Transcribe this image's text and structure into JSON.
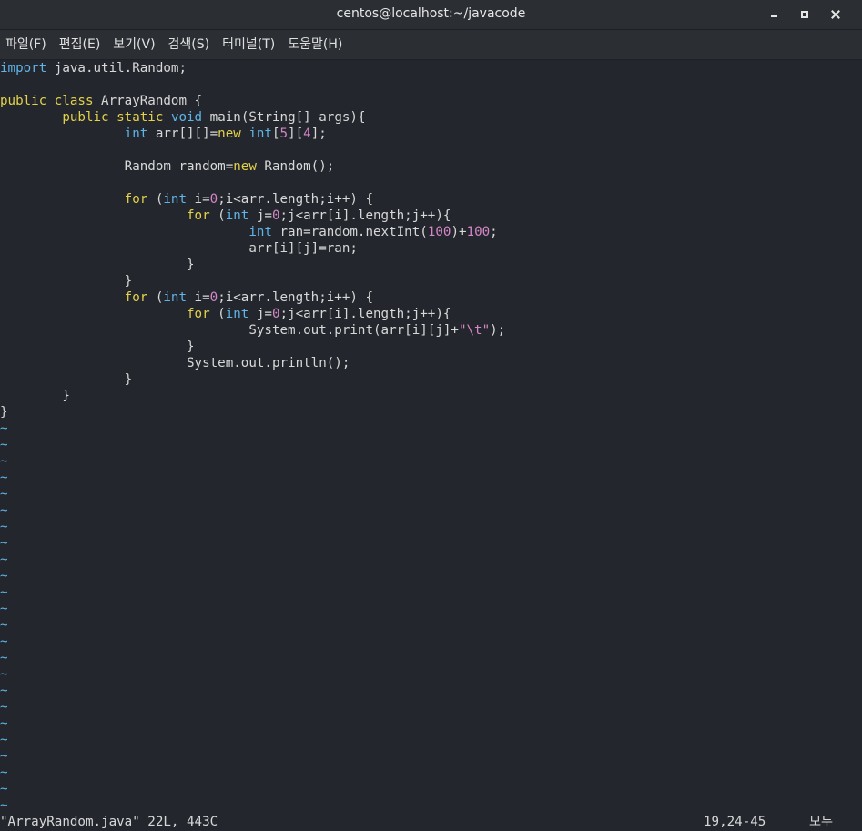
{
  "window": {
    "title": "centos@localhost:~/javacode",
    "controls": [
      "minimize",
      "maximize",
      "close"
    ]
  },
  "menu": [
    "파일(F)",
    "편집(E)",
    "보기(V)",
    "검색(S)",
    "터미널(T)",
    "도움말(H)"
  ],
  "code_lines": [
    [
      [
        "kw2",
        "import"
      ],
      [
        "t",
        " java.util.Random;"
      ]
    ],
    [],
    [
      [
        "kw",
        "public"
      ],
      [
        "t",
        " "
      ],
      [
        "kw",
        "class"
      ],
      [
        "t",
        " ArrayRandom {"
      ]
    ],
    [
      [
        "t",
        "        "
      ],
      [
        "kw",
        "public"
      ],
      [
        "t",
        " "
      ],
      [
        "kw",
        "static"
      ],
      [
        "t",
        " "
      ],
      [
        "ty",
        "void"
      ],
      [
        "t",
        " main(String[] args){"
      ]
    ],
    [
      [
        "t",
        "                "
      ],
      [
        "ty",
        "int"
      ],
      [
        "t",
        " arr[][]="
      ],
      [
        "kw",
        "new"
      ],
      [
        "t",
        " "
      ],
      [
        "ty",
        "int"
      ],
      [
        "t",
        "["
      ],
      [
        "nm",
        "5"
      ],
      [
        "t",
        "]["
      ],
      [
        "nm",
        "4"
      ],
      [
        "t",
        "];"
      ]
    ],
    [],
    [
      [
        "t",
        "                Random random="
      ],
      [
        "kw",
        "new"
      ],
      [
        "t",
        " Random();"
      ]
    ],
    [],
    [
      [
        "t",
        "                "
      ],
      [
        "kw",
        "for"
      ],
      [
        "t",
        " ("
      ],
      [
        "ty",
        "int"
      ],
      [
        "t",
        " i="
      ],
      [
        "nm",
        "0"
      ],
      [
        "t",
        ";i<arr.length;i++) {"
      ]
    ],
    [
      [
        "t",
        "                        "
      ],
      [
        "kw",
        "for"
      ],
      [
        "t",
        " ("
      ],
      [
        "ty",
        "int"
      ],
      [
        "t",
        " j="
      ],
      [
        "nm",
        "0"
      ],
      [
        "t",
        ";j<arr[i].length;j++){"
      ]
    ],
    [
      [
        "t",
        "                                "
      ],
      [
        "ty",
        "int"
      ],
      [
        "t",
        " ran=random.nextInt("
      ],
      [
        "nm",
        "100"
      ],
      [
        "t",
        ")+"
      ],
      [
        "nm",
        "100"
      ],
      [
        "t",
        ";"
      ]
    ],
    [
      [
        "t",
        "                                arr[i][j]=ran;"
      ]
    ],
    [
      [
        "t",
        "                        }"
      ]
    ],
    [
      [
        "t",
        "                }"
      ]
    ],
    [
      [
        "t",
        "                "
      ],
      [
        "kw",
        "for"
      ],
      [
        "t",
        " ("
      ],
      [
        "ty",
        "int"
      ],
      [
        "t",
        " i="
      ],
      [
        "nm",
        "0"
      ],
      [
        "t",
        ";i<arr.length;i++) {"
      ]
    ],
    [
      [
        "t",
        "                        "
      ],
      [
        "kw",
        "for"
      ],
      [
        "t",
        " ("
      ],
      [
        "ty",
        "int"
      ],
      [
        "t",
        " j="
      ],
      [
        "nm",
        "0"
      ],
      [
        "t",
        ";j<arr[i].length;j++){"
      ]
    ],
    [
      [
        "t",
        "                                System.out.print(arr[i][j]+"
      ],
      [
        "st",
        "\"\\t\""
      ],
      [
        "t",
        ");"
      ]
    ],
    [
      [
        "t",
        "                        }"
      ]
    ],
    [
      [
        "t",
        "                        System.out.println();"
      ]
    ],
    [
      [
        "t",
        "                }"
      ]
    ],
    [
      [
        "t",
        "        }"
      ]
    ],
    [
      [
        "t",
        "}"
      ]
    ]
  ],
  "empty_line_marker": "~",
  "empty_line_count": 24,
  "status": {
    "file_info": "\"ArrayRandom.java\" 22L, 443C",
    "cursor_position": "19,24-45",
    "scroll": "모두"
  },
  "colors": {
    "background": "#23272d",
    "keyword": "#e3d24a",
    "type": "#5fb4e8",
    "number": "#d586c6",
    "text": "#d8d8d8"
  }
}
